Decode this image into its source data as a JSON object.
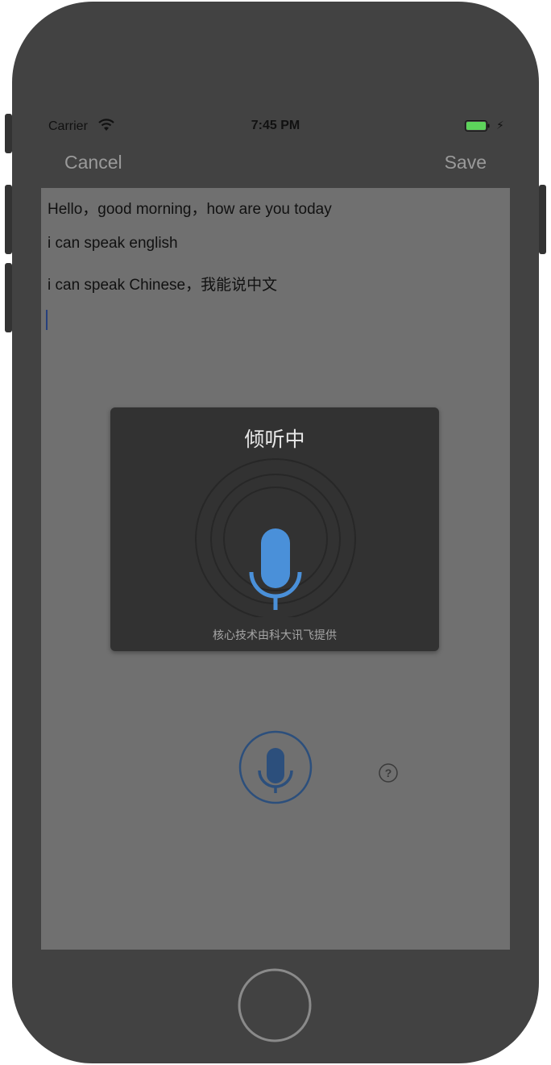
{
  "status_bar": {
    "carrier": "Carrier",
    "time": "7:45 PM",
    "battery_color": "#5dd35b"
  },
  "nav": {
    "cancel_label": "Cancel",
    "save_label": "Save",
    "button_color": "#9a9a9a"
  },
  "editor": {
    "lines": [
      "Hello，good morning，how are you today",
      "i can speak english",
      "i can speak Chinese，我能说中文"
    ],
    "caret_color": "#26407c"
  },
  "voice_dialog": {
    "title": "倾听中",
    "footer": "核心技术由科大讯飞提供",
    "mic_color": "#4a90d9"
  },
  "record_button": {
    "icon": "microphone-icon",
    "color": "#2c4f7c"
  },
  "help": {
    "icon": "question-circle-icon",
    "symbol": "?"
  },
  "colors": {
    "phone_body": "#424242",
    "screen_dim": "#707070",
    "dialog_bg": "#323232"
  }
}
